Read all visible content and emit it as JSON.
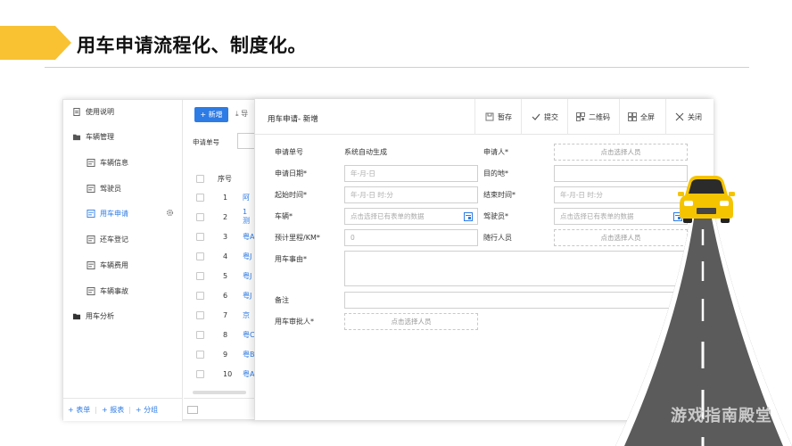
{
  "header": {
    "title": "用车申请流程化、制度化。"
  },
  "sidebar": {
    "items": [
      {
        "label": "使用说明",
        "icon": "doc-icon",
        "level": "top"
      },
      {
        "label": "车辆管理",
        "icon": "folder-open-icon",
        "level": "top"
      },
      {
        "label": "车辆信息",
        "icon": "form-icon",
        "level": "sub"
      },
      {
        "label": "驾驶员",
        "icon": "form-icon",
        "level": "sub"
      },
      {
        "label": "用车申请",
        "icon": "form-icon",
        "level": "sub",
        "active": true
      },
      {
        "label": "还车登记",
        "icon": "form-icon",
        "level": "sub"
      },
      {
        "label": "车辆费用",
        "icon": "form-icon",
        "level": "sub"
      },
      {
        "label": "车辆事故",
        "icon": "form-icon",
        "level": "sub"
      },
      {
        "label": "用车分析",
        "icon": "folder-icon",
        "level": "top"
      }
    ],
    "footer": {
      "add_form": "+ 表单",
      "add_report": "+ 报表",
      "add_group": "+ 分组"
    }
  },
  "list": {
    "new_button": "+ 新增",
    "export_button": "⤓ 导",
    "filter_label": "申请单号",
    "col_index": "序号",
    "rows": [
      {
        "num": "1",
        "link": "阿"
      },
      {
        "num": "2",
        "link": "1 测"
      },
      {
        "num": "3",
        "link": "粤A"
      },
      {
        "num": "4",
        "link": "粤J"
      },
      {
        "num": "5",
        "link": "粤J"
      },
      {
        "num": "6",
        "link": "粤J"
      },
      {
        "num": "7",
        "link": "京"
      },
      {
        "num": "8",
        "link": "粤C"
      },
      {
        "num": "9",
        "link": "粤B"
      },
      {
        "num": "10",
        "link": "粤A"
      }
    ]
  },
  "modal": {
    "title": "用车申请- 新增",
    "toolbar": {
      "save_draft": "暂存",
      "submit": "提交",
      "qrcode": "二维码",
      "fullscreen": "全屏",
      "close": "关闭"
    },
    "fields": {
      "apply_no_label": "申请单号",
      "apply_no_value": "系统自动生成",
      "applicant_label": "申请人*",
      "applicant_placeholder": "点击选择人员",
      "apply_date_label": "申请日期*",
      "apply_date_placeholder": "年-月-日",
      "destination_label": "目的地*",
      "start_time_label": "起始时间*",
      "start_time_placeholder": "年-月-日 时:分",
      "end_time_label": "结束时间*",
      "end_time_placeholder": "年-月-日 时:分",
      "vehicle_label": "车辆*",
      "vehicle_placeholder": "点击选择已有表单的数据",
      "driver_label": "驾驶员*",
      "driver_placeholder": "点击选择已有表单的数据",
      "mileage_label": "预计里程/KM*",
      "mileage_value": "0",
      "companions_label": "随行人员",
      "companions_placeholder": "点击选择人员",
      "reason_label": "用车事由*",
      "remark_label": "备注",
      "approver_label": "用车审批人*",
      "approver_placeholder": "点击选择人员"
    }
  },
  "watermark": "游戏指南殿堂",
  "colors": {
    "accent": "#2d7be5",
    "header_arrow": "#f8c233",
    "road": "#5b5b5b",
    "car": "#f5c400"
  }
}
